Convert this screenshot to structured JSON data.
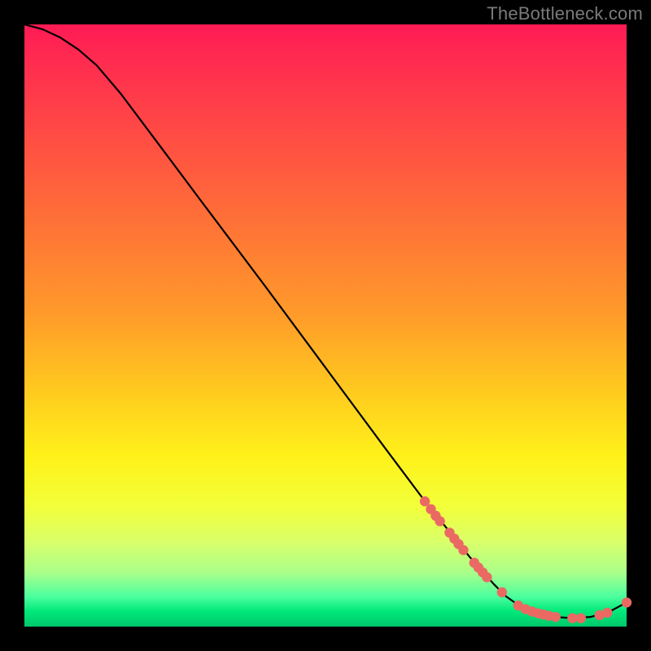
{
  "watermark": "TheBottleneck.com",
  "chart_data": {
    "type": "line",
    "title": "",
    "xlabel": "",
    "ylabel": "",
    "xlim": [
      0,
      100
    ],
    "ylim": [
      0,
      100
    ],
    "grid": false,
    "legend": null,
    "curve": [
      {
        "x": 0,
        "y": 100
      },
      {
        "x": 3,
        "y": 99.2
      },
      {
        "x": 6,
        "y": 97.8
      },
      {
        "x": 9,
        "y": 95.8
      },
      {
        "x": 12,
        "y": 93.2
      },
      {
        "x": 16,
        "y": 88.5
      },
      {
        "x": 22,
        "y": 80.5
      },
      {
        "x": 30,
        "y": 69.8
      },
      {
        "x": 40,
        "y": 56.5
      },
      {
        "x": 50,
        "y": 43.0
      },
      {
        "x": 60,
        "y": 29.5
      },
      {
        "x": 66,
        "y": 21.5
      },
      {
        "x": 70,
        "y": 16.5
      },
      {
        "x": 74,
        "y": 11.5
      },
      {
        "x": 78,
        "y": 7.0
      },
      {
        "x": 80,
        "y": 5.0
      },
      {
        "x": 82,
        "y": 3.6
      },
      {
        "x": 85,
        "y": 2.3
      },
      {
        "x": 88,
        "y": 1.6
      },
      {
        "x": 91,
        "y": 1.4
      },
      {
        "x": 94,
        "y": 1.6
      },
      {
        "x": 97,
        "y": 2.4
      },
      {
        "x": 100,
        "y": 4.0
      }
    ],
    "markers": [
      {
        "x": 66.5,
        "y": 20.8
      },
      {
        "x": 67.5,
        "y": 19.5
      },
      {
        "x": 68.3,
        "y": 18.4
      },
      {
        "x": 69.0,
        "y": 17.5
      },
      {
        "x": 70.6,
        "y": 15.6
      },
      {
        "x": 71.4,
        "y": 14.6
      },
      {
        "x": 72.1,
        "y": 13.7
      },
      {
        "x": 72.9,
        "y": 12.7
      },
      {
        "x": 74.7,
        "y": 10.6
      },
      {
        "x": 75.4,
        "y": 9.8
      },
      {
        "x": 76.1,
        "y": 9.0
      },
      {
        "x": 76.8,
        "y": 8.2
      },
      {
        "x": 79.3,
        "y": 5.7
      },
      {
        "x": 82.0,
        "y": 3.5
      },
      {
        "x": 83.2,
        "y": 2.9
      },
      {
        "x": 84.3,
        "y": 2.5
      },
      {
        "x": 85.3,
        "y": 2.2
      },
      {
        "x": 86.2,
        "y": 2.0
      },
      {
        "x": 87.1,
        "y": 1.8
      },
      {
        "x": 88.2,
        "y": 1.6
      },
      {
        "x": 91.0,
        "y": 1.4
      },
      {
        "x": 92.4,
        "y": 1.4
      },
      {
        "x": 95.5,
        "y": 1.9
      },
      {
        "x": 96.8,
        "y": 2.3
      },
      {
        "x": 100.0,
        "y": 4.0
      }
    ],
    "curve_color": "#000000",
    "marker_color": "#ea6a63",
    "background_gradient_top": "#ff1b55",
    "background_gradient_bottom": "#00c86c"
  }
}
